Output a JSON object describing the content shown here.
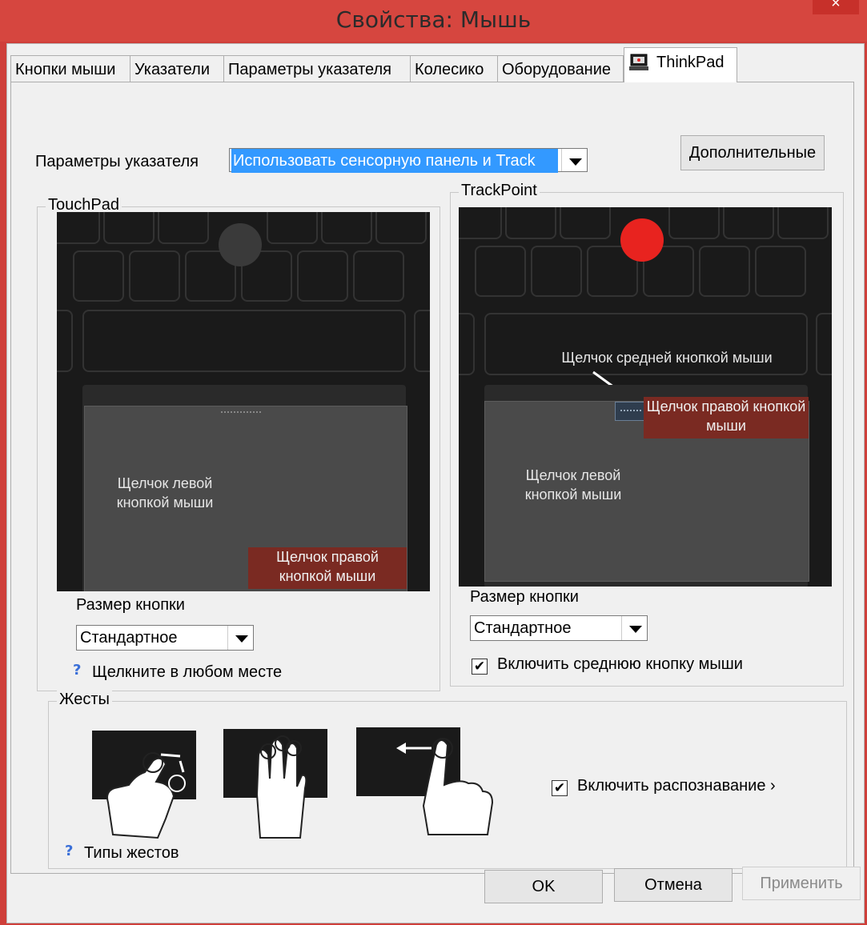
{
  "window": {
    "title": "Свойства: Мышь",
    "close_glyph": "×"
  },
  "tabs": [
    {
      "label": "Кнопки мыши"
    },
    {
      "label": "Указатели"
    },
    {
      "label": "Параметры указателя"
    },
    {
      "label": "Колесико"
    },
    {
      "label": "Оборудование"
    },
    {
      "label": "ThinkPad"
    }
  ],
  "pointer_settings": {
    "label": "Параметры указателя",
    "selected": "Использовать сенсорную панель и Track",
    "advanced_button": "Дополнительные"
  },
  "touchpad": {
    "group_title": "TouchPad",
    "left_click": "Щелчок левой кнопкой мыши",
    "right_click": "Щелчок правой кнопкой мыши",
    "button_size_label": "Размер кнопки",
    "button_size_value": "Стандартное",
    "help_link": "Щелкните в любом месте"
  },
  "trackpoint": {
    "group_title": "TrackPoint",
    "middle_click": "Щелчок средней кнопкой мыши",
    "right_click": "Щелчок правой кнопкой мыши",
    "left_click": "Щелчок левой кнопкой мыши",
    "button_size_label": "Размер кнопки",
    "button_size_value": "Стандартное",
    "enable_middle": "Включить среднюю кнопку мыши",
    "enable_middle_checked": true,
    "pointer_color": "#e8231f"
  },
  "gestures": {
    "group_title": "Жесты",
    "enable_recognition": "Включить распознавание ›",
    "enable_checked": true,
    "help_link": "Типы жестов"
  },
  "buttons": {
    "ok": "OK",
    "cancel": "Отмена",
    "apply": "Применить"
  },
  "icons": {
    "check": "✔",
    "help": "?"
  }
}
